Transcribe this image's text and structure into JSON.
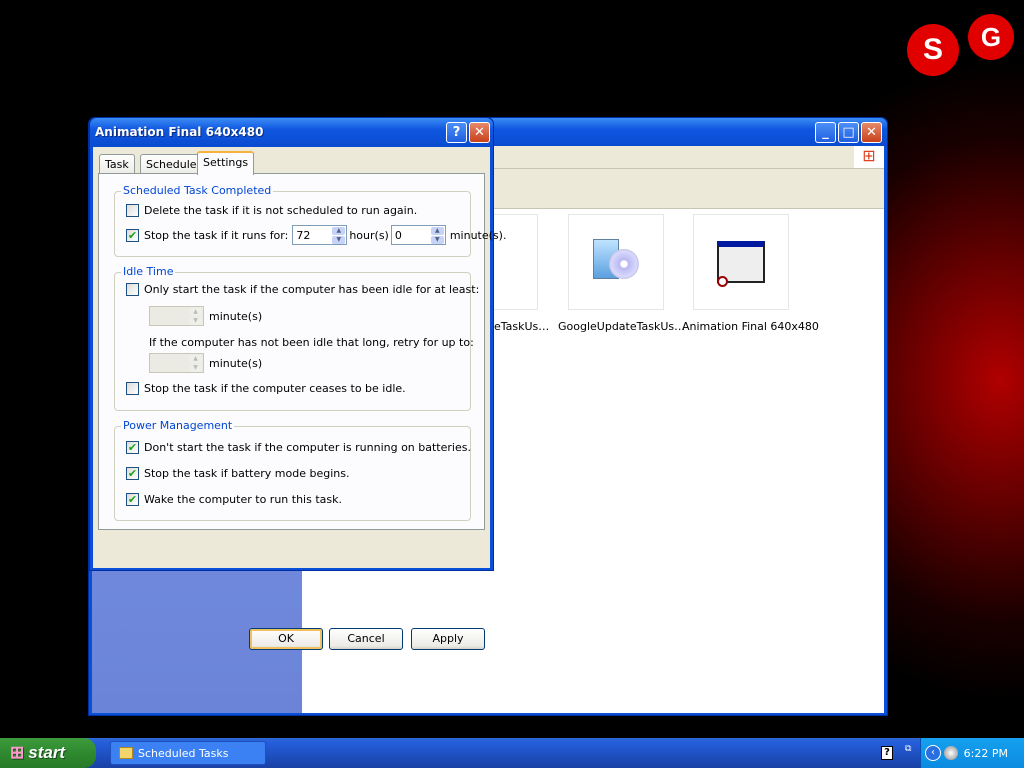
{
  "explorer": {
    "title": "",
    "items": [
      {
        "label": "GoogleUpdateTaskUs…",
        "icon": "installer-cd-icon"
      },
      {
        "label": "GoogleUpdateTaskUs…",
        "icon": "installer-cd-icon"
      },
      {
        "label": "Animation Final 640x480",
        "icon": "window-task-icon"
      }
    ],
    "partial_first_label": "eTaskUs…"
  },
  "dialog": {
    "title": "Animation Final 640x480",
    "tabs": [
      {
        "label": "Task"
      },
      {
        "label": "Schedule"
      },
      {
        "label": "Settings",
        "active": true
      }
    ],
    "completed": {
      "title": "Scheduled Task Completed",
      "delete_label": "Delete the task if it is not scheduled to run again.",
      "delete_checked": false,
      "stop_label": "Stop the task if it runs for:",
      "stop_checked": true,
      "hours": "72",
      "hours_unit": "hour(s)",
      "minutes": "0",
      "minutes_unit": "minute(s)."
    },
    "idle": {
      "title": "Idle Time",
      "only_label": "Only start the task if the computer has been idle for at least:",
      "only_checked": false,
      "minutes_unit": "minute(s)",
      "retry_label": "If the computer has not been idle that long, retry for up to:",
      "retry_unit": "minute(s)",
      "stop_label": "Stop the task if the computer ceases to be idle.",
      "stop_checked": false
    },
    "power": {
      "title": "Power Management",
      "batteries_label": "Don't start the task if the computer is running on batteries.",
      "batteries_checked": true,
      "battery_mode_label": "Stop the task if battery mode begins.",
      "battery_mode_checked": true,
      "wake_label": "Wake the computer to run this task.",
      "wake_checked": true
    },
    "buttons": {
      "ok": "OK",
      "cancel": "Cancel",
      "apply": "Apply"
    }
  },
  "taskbar": {
    "start": "start",
    "task": "Scheduled Tasks",
    "clock": "6:22 PM"
  },
  "desktop": {
    "logo": "SG"
  }
}
